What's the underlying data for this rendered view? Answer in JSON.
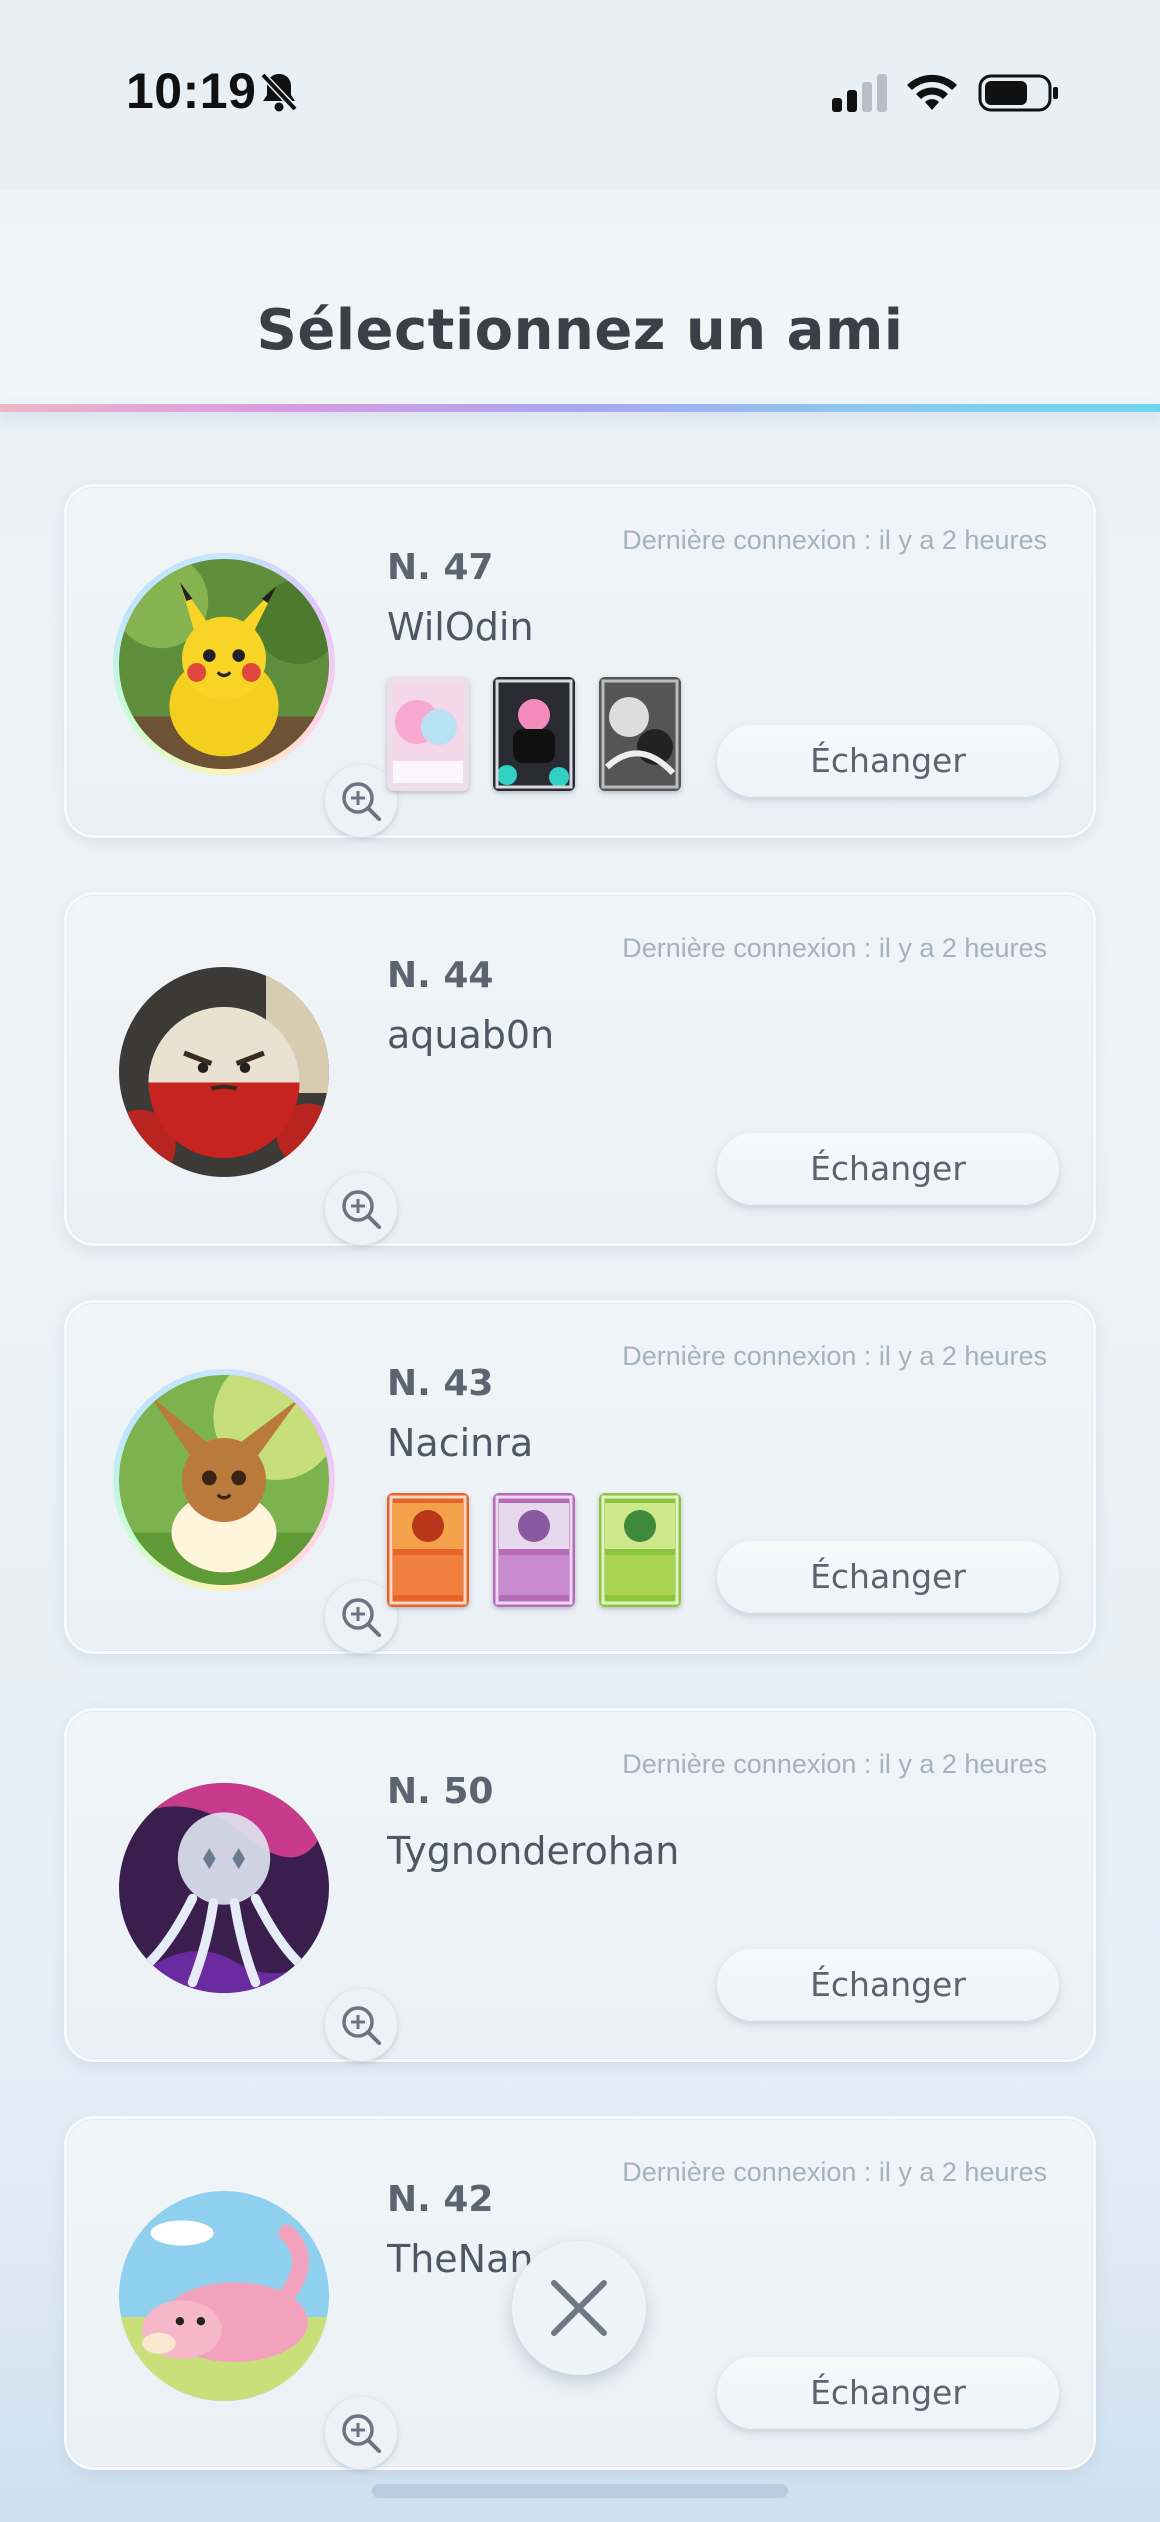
{
  "status_bar": {
    "time": "10:19",
    "icons": [
      "bell-slash-icon",
      "cellular-signal-icon",
      "wifi-icon",
      "battery-icon"
    ]
  },
  "header": {
    "title": "Sélectionnez un ami"
  },
  "close_icon": "close-icon",
  "friends": [
    {
      "number": "N. 47",
      "name": "WilOdin",
      "last_login": "Dernière connexion : il y a 2 heures",
      "trade_label": "Échanger",
      "avatar": "pikachu-avatar",
      "cards": [
        "sylveon-card",
        "bewear-card",
        "monochrome-card"
      ]
    },
    {
      "number": "N. 44",
      "name": "aquab0n",
      "last_login": "Dernière connexion : il y a 2 heures",
      "trade_label": "Échanger",
      "avatar": "electrode-plush-avatar",
      "cards": []
    },
    {
      "number": "N. 43",
      "name": "Nacinra",
      "last_login": "Dernière connexion : il y a 2 heures",
      "trade_label": "Échanger",
      "avatar": "eevee-avatar",
      "cards": [
        "fire-card",
        "psychic-card",
        "grass-card"
      ]
    },
    {
      "number": "N. 50",
      "name": "Tygnonderohan",
      "last_login": "Dernière connexion : il y a 2 heures",
      "trade_label": "Échanger",
      "avatar": "nihilego-avatar",
      "cards": []
    },
    {
      "number": "N. 42",
      "name": "TheNan",
      "last_login": "Dernière connexion : il y a 2 heures",
      "trade_label": "Échanger",
      "avatar": "slowpoke-avatar",
      "cards": []
    }
  ]
}
